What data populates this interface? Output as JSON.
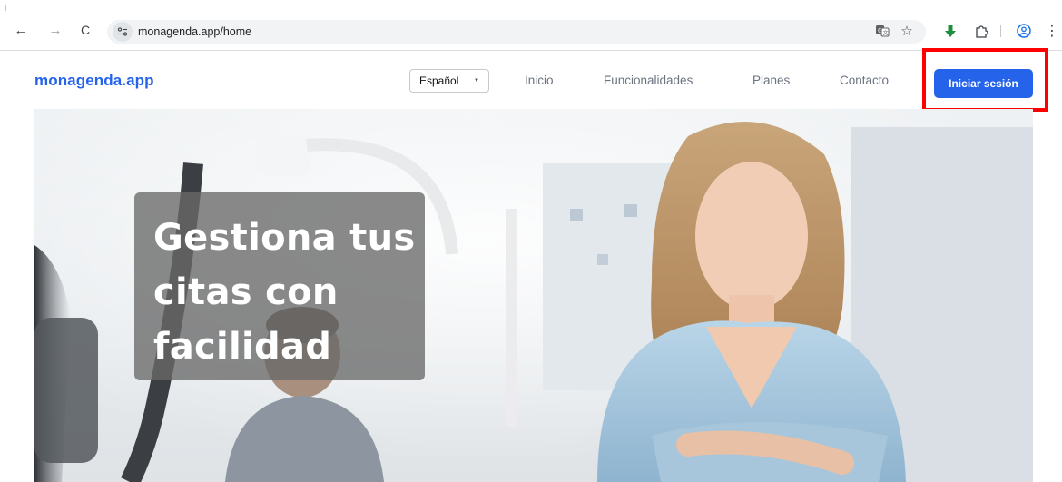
{
  "browser": {
    "url": "monagenda.app/home",
    "back_glyph": "←",
    "forward_glyph": "→",
    "reload_glyph": "C",
    "menu_glyph": "⋮",
    "star_glyph": "☆",
    "icons": [
      "arrow-left-icon",
      "arrow-right-icon",
      "reload-icon",
      "site-info-icon",
      "translate-icon",
      "star-icon",
      "download-icon",
      "extensions-icon",
      "profile-icon",
      "more-menu-icon"
    ]
  },
  "header": {
    "logo": "monagenda.app",
    "language": {
      "selected": "Español"
    },
    "nav": [
      "Inicio",
      "Funcionalidades",
      "Planes",
      "Contacto"
    ],
    "login_label": "Iniciar sesión"
  },
  "hero": {
    "title_lines": [
      "Gestiona tus",
      "citas con",
      "facilidad"
    ]
  },
  "colors": {
    "brand": "#2563eb",
    "highlight": "#ff0000",
    "nav_text": "#6b7280"
  }
}
